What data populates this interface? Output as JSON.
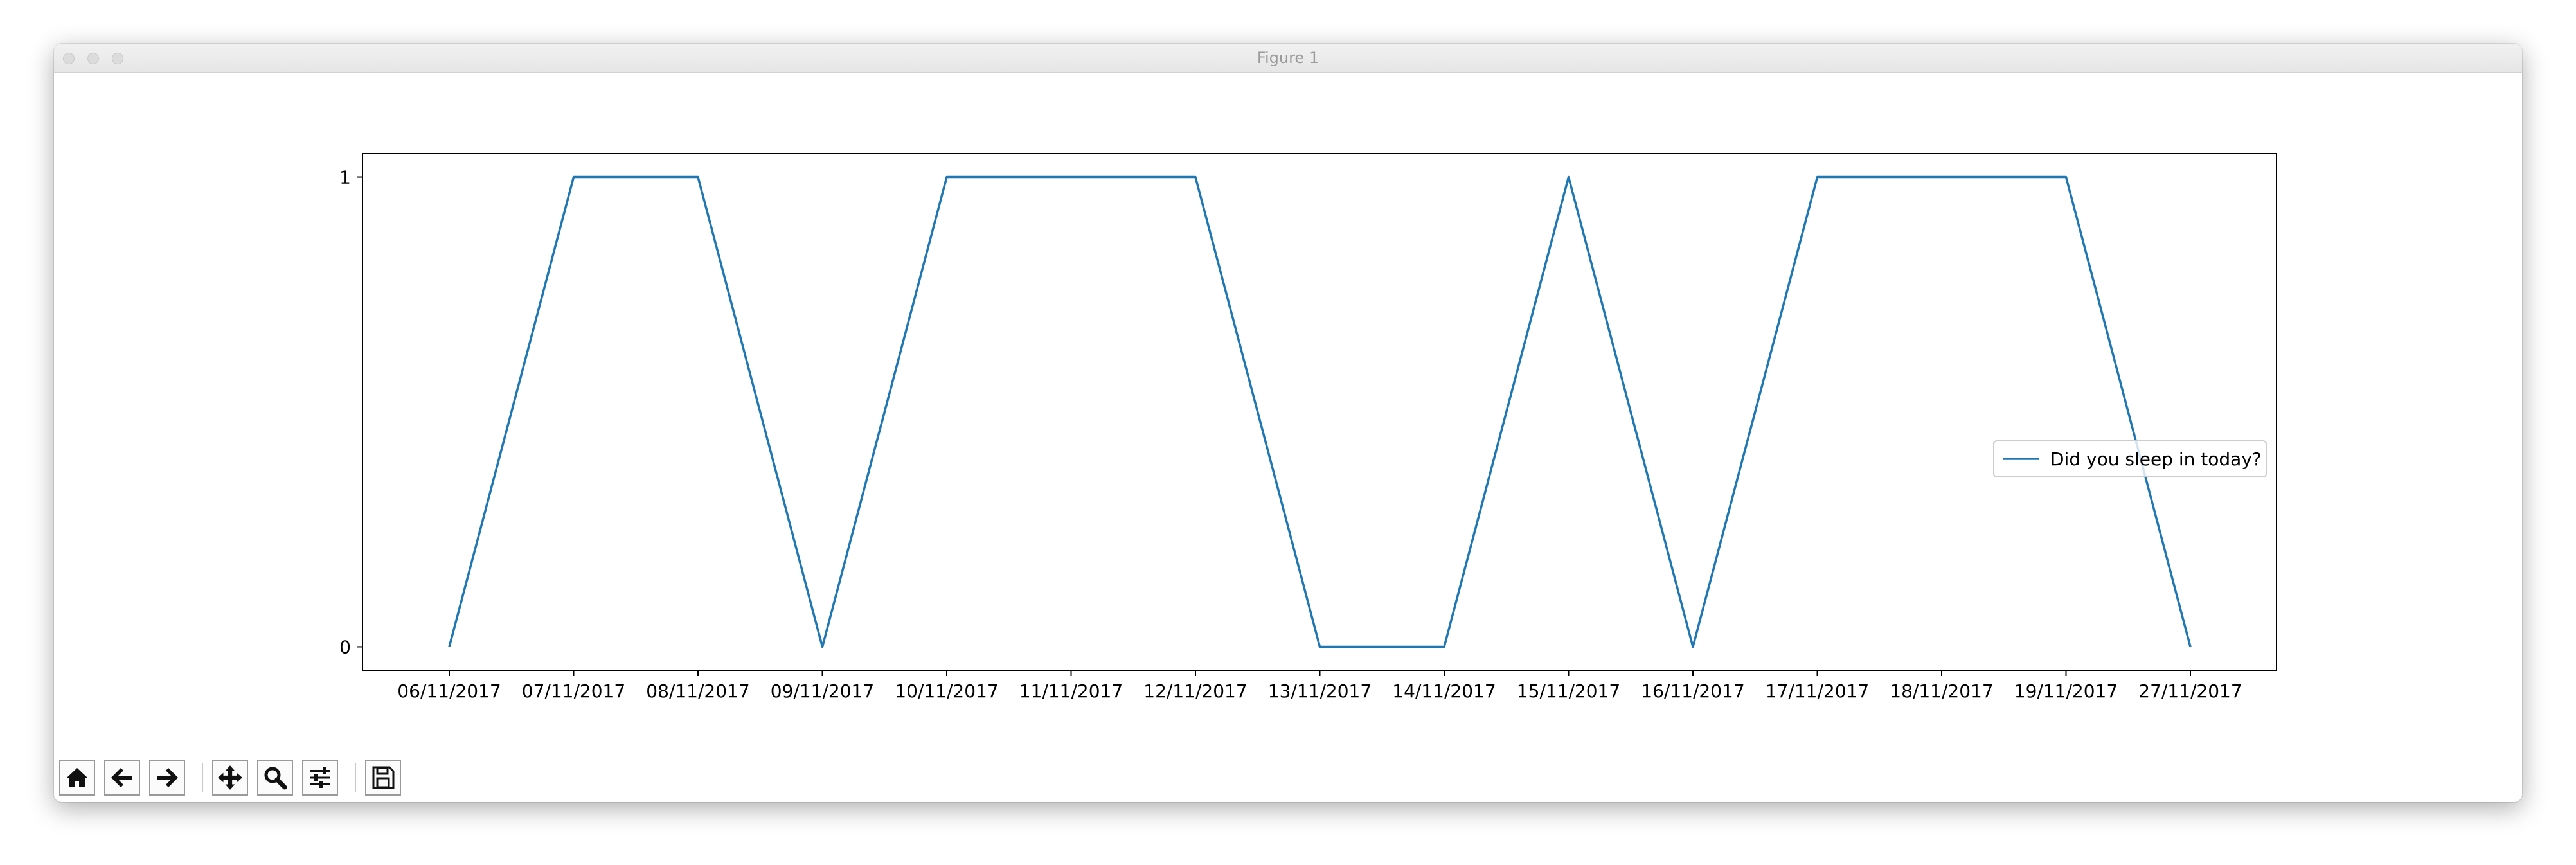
{
  "window": {
    "title": "Figure 1"
  },
  "toolbar": {
    "buttons": [
      {
        "name": "home-button",
        "icon": "home-icon"
      },
      {
        "name": "back-button",
        "icon": "arrow-left-icon"
      },
      {
        "name": "forward-button",
        "icon": "arrow-right-icon"
      },
      {
        "name": "pan-button",
        "icon": "move-icon"
      },
      {
        "name": "zoom-button",
        "icon": "magnifier-icon"
      },
      {
        "name": "configure-subplots-button",
        "icon": "sliders-icon"
      },
      {
        "name": "save-button",
        "icon": "floppy-disk-icon"
      }
    ]
  },
  "chart_data": {
    "type": "line",
    "title": "",
    "xlabel": "",
    "ylabel": "",
    "categories": [
      "06/11/2017",
      "07/11/2017",
      "08/11/2017",
      "09/11/2017",
      "10/11/2017",
      "11/11/2017",
      "12/11/2017",
      "13/11/2017",
      "14/11/2017",
      "15/11/2017",
      "16/11/2017",
      "17/11/2017",
      "18/11/2017",
      "19/11/2017",
      "27/11/2017"
    ],
    "yticks": [
      "0",
      "1"
    ],
    "ylim": [
      -0.05,
      1.05
    ],
    "series": [
      {
        "name": "Did you sleep in today?",
        "values": [
          0,
          1,
          1,
          0,
          1,
          1,
          1,
          0,
          0,
          1,
          0,
          1,
          1,
          1,
          0
        ],
        "color": "#1f77b4"
      }
    ],
    "legend": "center-right",
    "grid": false
  }
}
